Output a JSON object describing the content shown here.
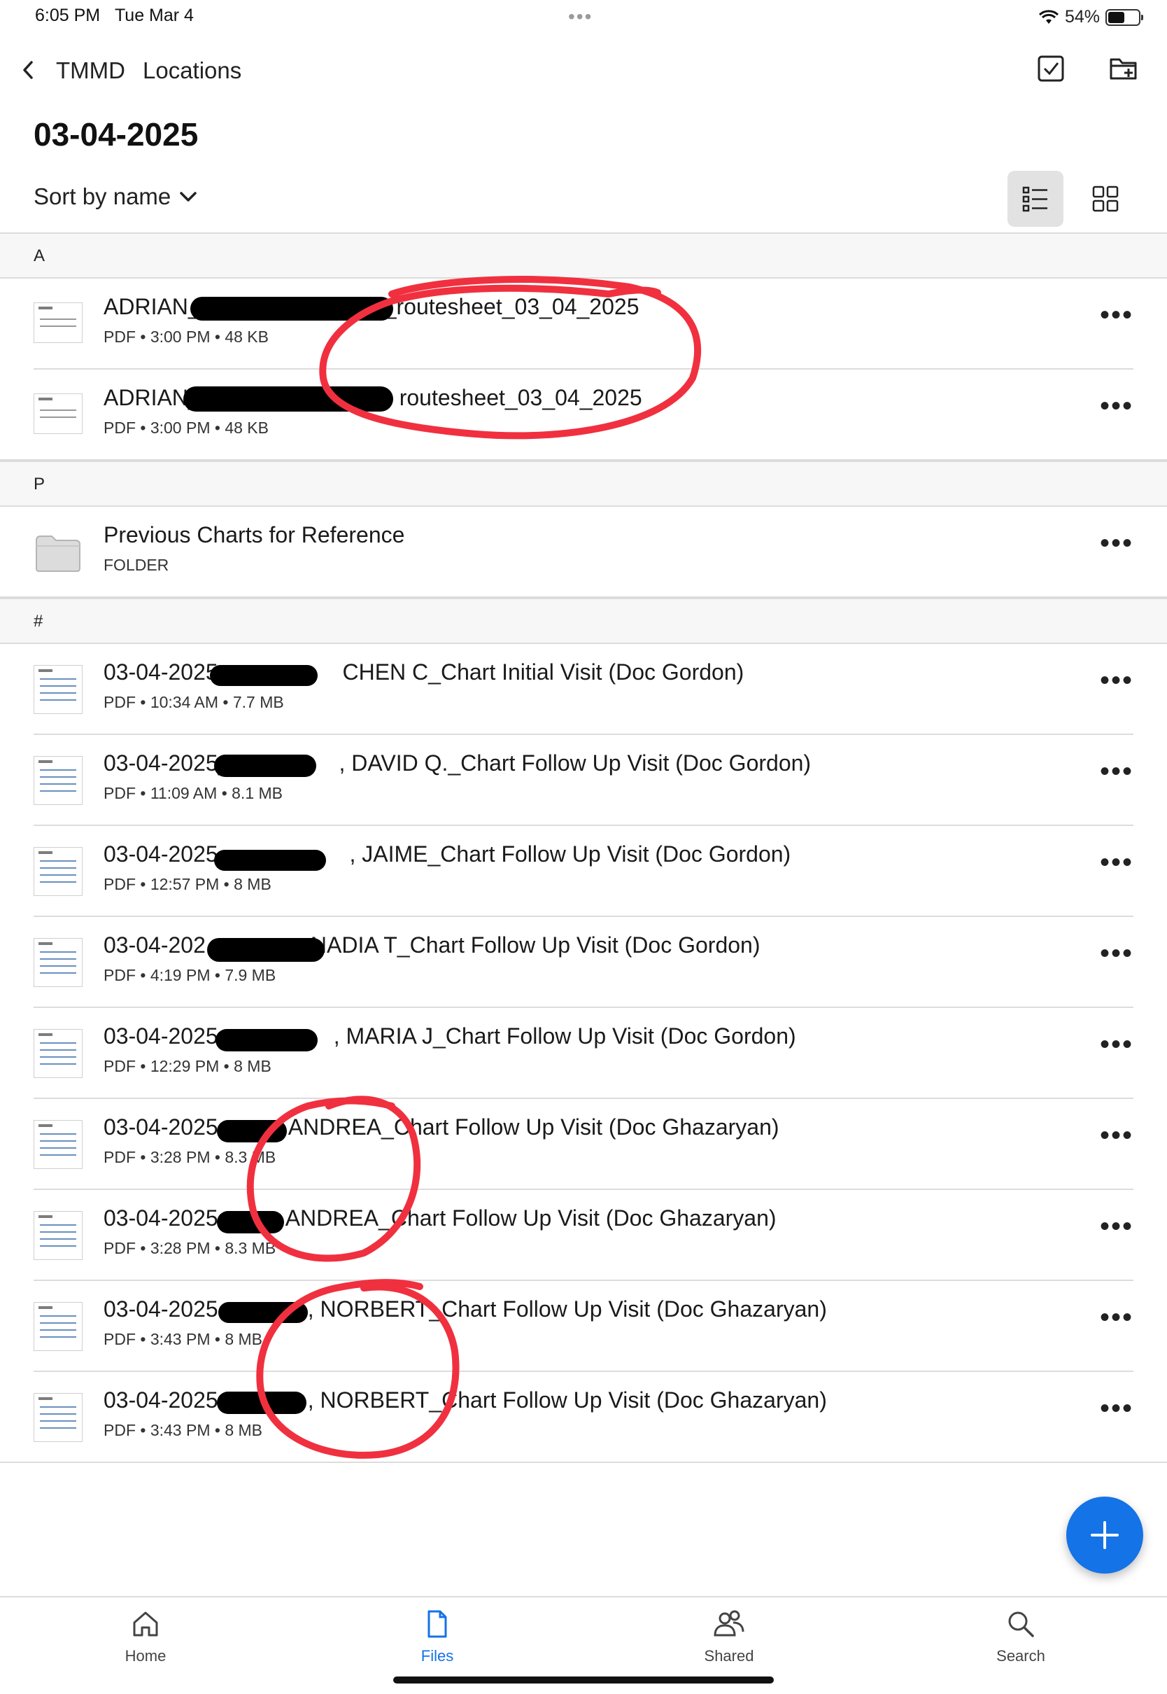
{
  "status": {
    "time": "6:05 PM",
    "date": "Tue Mar 4",
    "battery": "54%",
    "battery_level": 0.54
  },
  "nav": {
    "back_label": "TMMD",
    "current": "Locations"
  },
  "title": "03-04-2025",
  "sort": {
    "label": "Sort by name"
  },
  "sections": [
    {
      "letter": "A",
      "items": [
        {
          "name_pre": "ADRIAN_",
          "name_post": "_routesheet_03_04_2025",
          "meta": "PDF  •  3:00 PM  •  48 KB"
        },
        {
          "name_pre": "ADRIAN_",
          "name_post": "routesheet_03_04_2025",
          "meta": "PDF  •  3:00 PM  •  48 KB"
        }
      ]
    },
    {
      "letter": "P",
      "items": [
        {
          "name": "Previous Charts for Reference",
          "meta": "FOLDER"
        }
      ]
    },
    {
      "letter": "#",
      "items": [
        {
          "name_pre": "03-04-2025_",
          "name_post": "CHEN C_Chart Initial Visit (Doc Gordon)",
          "meta": "PDF  •  10:34 AM  •  7.7 MB"
        },
        {
          "name_pre": "03-04-2025_",
          "name_post": ", DAVID Q._Chart Follow Up Visit (Doc Gordon)",
          "meta": "PDF  •  11:09 AM  •  8.1 MB"
        },
        {
          "name_pre": "03-04-2025_",
          "name_post": ", JAIME_Chart Follow Up Visit (Doc Gordon)",
          "meta": "PDF  •  12:57 PM  •  8 MB"
        },
        {
          "name_pre": "03-04-202",
          "name_post": "NADIA T_Chart Follow Up Visit (Doc Gordon)",
          "meta": "PDF  •  4:19 PM  •  7.9 MB"
        },
        {
          "name_pre": "03-04-2025",
          "name_post": ", MARIA J_Chart Follow Up Visit (Doc Gordon)",
          "meta": "PDF  •  12:29 PM  •  8 MB"
        },
        {
          "name_pre": "03-04-2025",
          "name_post": "ANDREA_Chart Follow Up Visit (Doc Ghazaryan)",
          "meta": "PDF  •  3:28 PM  •  8.3 MB"
        },
        {
          "name_pre": "03-04-2025",
          "name_post": "ANDREA_Chart Follow Up Visit (Doc Ghazaryan)",
          "meta": "PDF  •  3:28 PM  •  8.3 MB"
        },
        {
          "name_pre": "03-04-2025",
          "name_post": ", NORBERT_Chart Follow Up Visit (Doc Ghazaryan)",
          "meta": "PDF  •  3:43 PM  •  8 MB"
        },
        {
          "name_pre": "03-04-2025",
          "name_post": ", NORBERT_Chart Follow Up Visit (Doc Ghazaryan)",
          "meta": "PDF  •  3:43 PM  •  8 MB"
        }
      ]
    }
  ],
  "more_glyph": "•••",
  "tabs": [
    {
      "label": "Home",
      "icon": "home-icon"
    },
    {
      "label": "Files",
      "icon": "files-icon"
    },
    {
      "label": "Shared",
      "icon": "shared-icon"
    },
    {
      "label": "Search",
      "icon": "search-icon"
    }
  ],
  "colors": {
    "accent": "#1473e6",
    "annotation": "#f0303f",
    "redaction": "#000000"
  }
}
